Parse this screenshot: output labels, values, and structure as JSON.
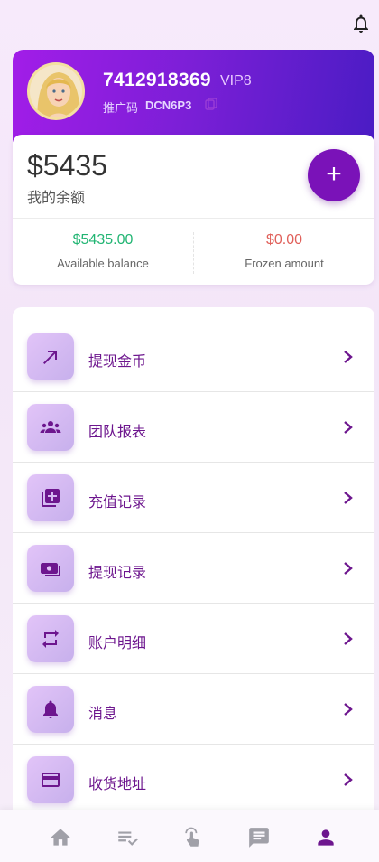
{
  "profile": {
    "uid": "7412918369",
    "vip": "VIP8",
    "referral_label": "推广码",
    "referral_code": "DCN6P3"
  },
  "balance": {
    "amount": "$5435",
    "label": "我的余额",
    "add_symbol": "+",
    "available_value": "$5435.00",
    "available_label": "Available balance",
    "frozen_value": "$0.00",
    "frozen_label": "Frozen amount"
  },
  "menu": {
    "items": [
      {
        "label": "提现金币",
        "icon": "arrow-up-right-icon"
      },
      {
        "label": "团队报表",
        "icon": "group-icon"
      },
      {
        "label": "充值记录",
        "icon": "add-box-icon"
      },
      {
        "label": "提现记录",
        "icon": "money-icon"
      },
      {
        "label": "账户明细",
        "icon": "repeat-icon"
      },
      {
        "label": "消息",
        "icon": "bell-icon"
      },
      {
        "label": "收货地址",
        "icon": "credit-card-icon"
      }
    ]
  },
  "nav": {
    "items": [
      "home-icon",
      "tasks-icon",
      "tap-icon",
      "chat-icon",
      "profile-icon"
    ],
    "active": "profile-icon"
  },
  "colors": {
    "accent": "#7a12b8",
    "available": "#22b573",
    "frozen": "#e0605a"
  }
}
